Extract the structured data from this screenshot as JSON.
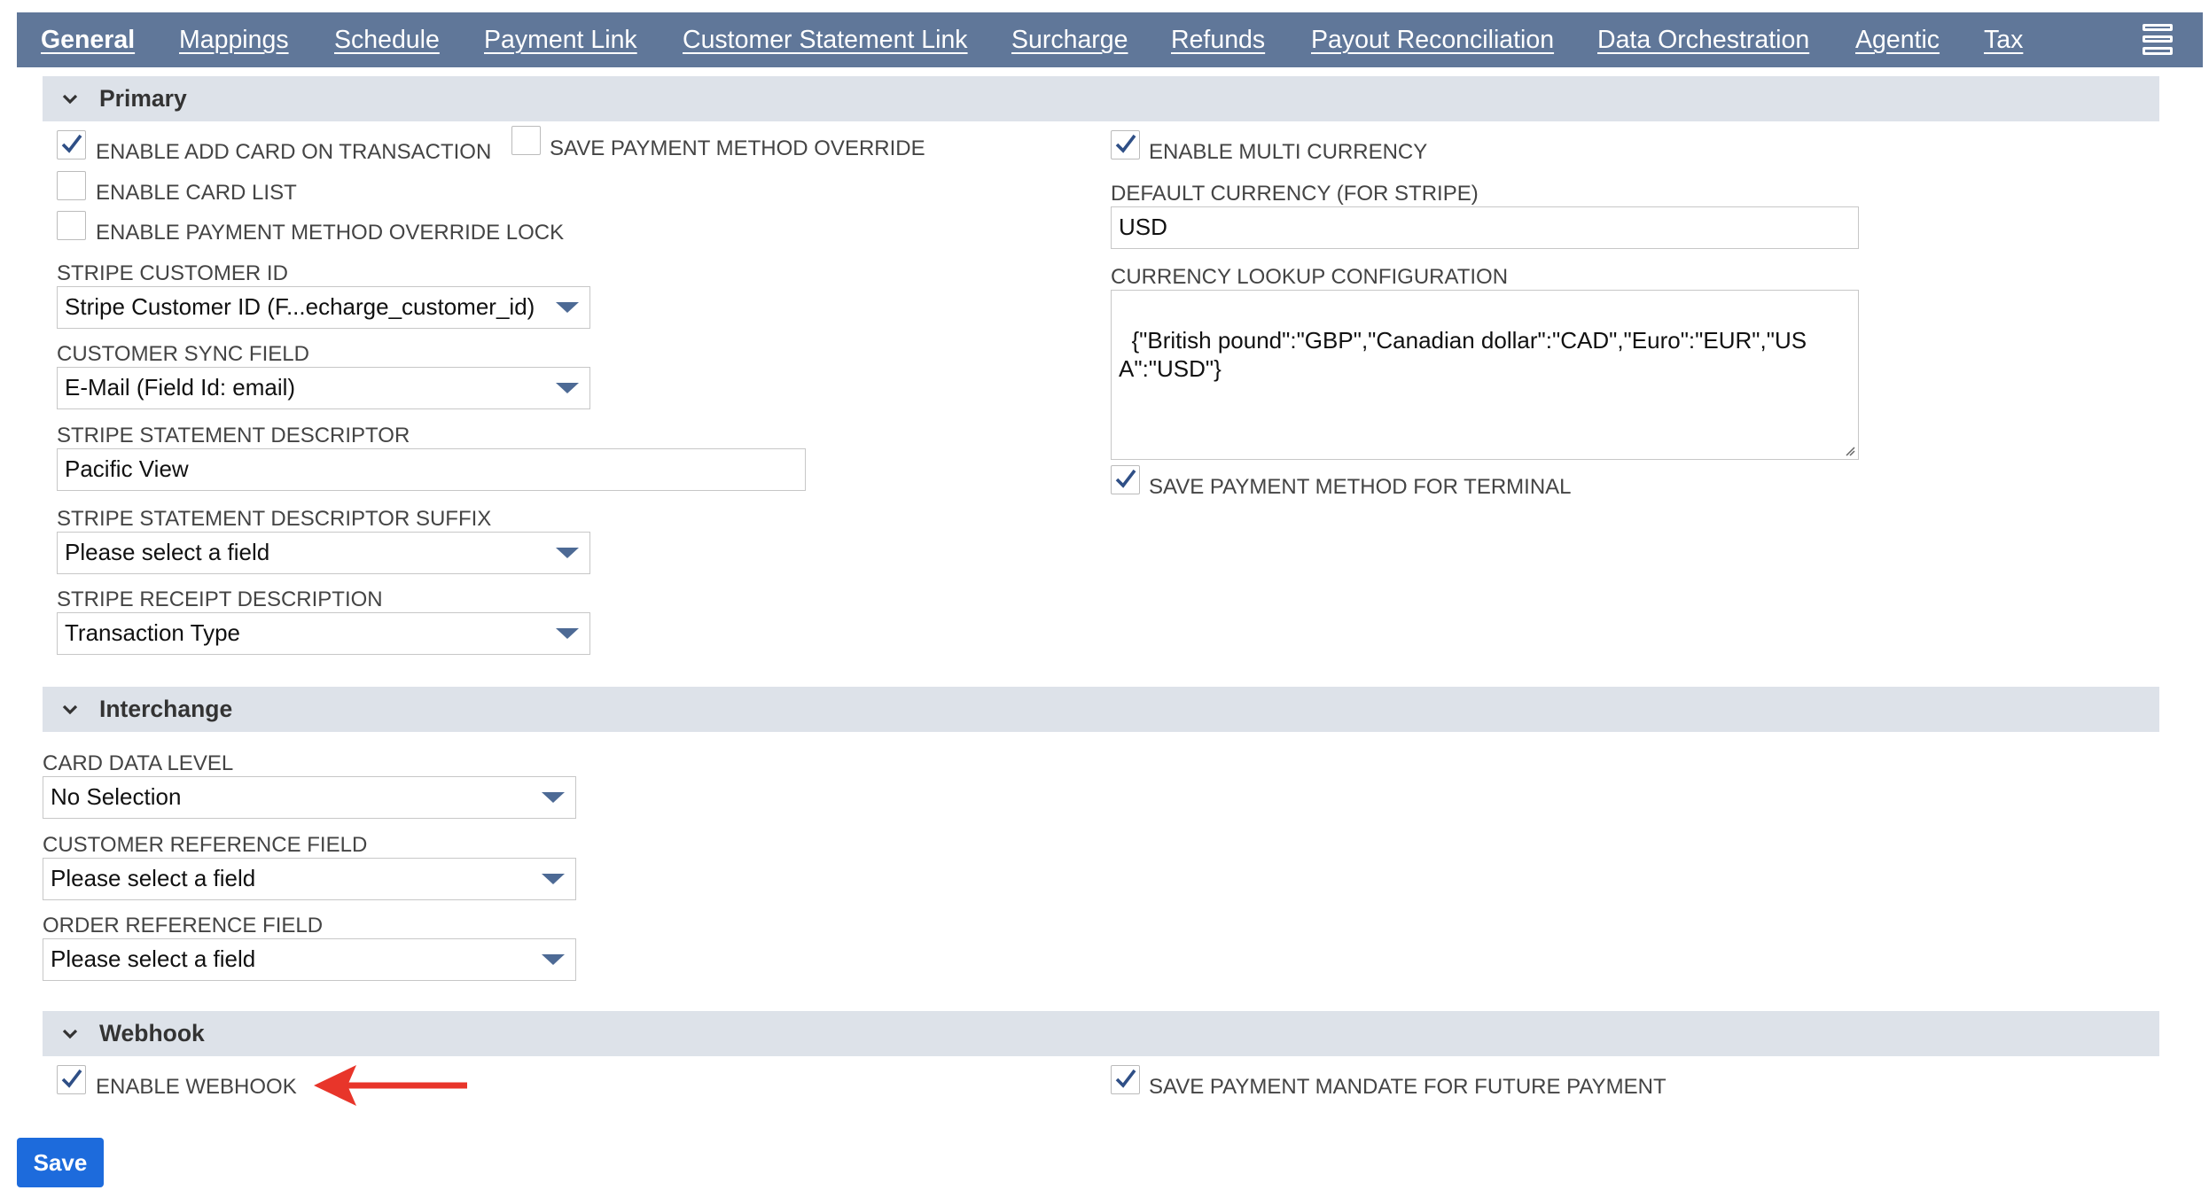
{
  "tabs": [
    {
      "label": "General",
      "active": true
    },
    {
      "label": "Mappings"
    },
    {
      "label": "Schedule"
    },
    {
      "label": "Payment Link"
    },
    {
      "label": "Customer Statement Link"
    },
    {
      "label": "Surcharge"
    },
    {
      "label": "Refunds"
    },
    {
      "label": "Payout Reconciliation"
    },
    {
      "label": "Data Orchestration"
    },
    {
      "label": "Agentic"
    },
    {
      "label": "Tax"
    }
  ],
  "sections": {
    "primary": {
      "title": "Primary",
      "enable_add_card": {
        "label": "ENABLE ADD CARD ON TRANSACTION",
        "checked": true
      },
      "save_pm_override": {
        "label": "SAVE PAYMENT METHOD OVERRIDE",
        "checked": false
      },
      "enable_card_list": {
        "label": "ENABLE CARD LIST",
        "checked": false
      },
      "enable_pm_override_lock": {
        "label": "ENABLE PAYMENT METHOD OVERRIDE LOCK",
        "checked": false
      },
      "stripe_customer_id": {
        "label": "STRIPE CUSTOMER ID",
        "value": "Stripe Customer ID (F...echarge_customer_id)"
      },
      "customer_sync_field": {
        "label": "CUSTOMER SYNC FIELD",
        "value": "E-Mail (Field Id: email)"
      },
      "statement_descriptor": {
        "label": "STRIPE STATEMENT DESCRIPTOR",
        "value": "Pacific View"
      },
      "statement_descriptor_suffix": {
        "label": "STRIPE STATEMENT DESCRIPTOR SUFFIX",
        "value": "Please select a field"
      },
      "receipt_description": {
        "label": "STRIPE RECEIPT DESCRIPTION",
        "value": "Transaction Type"
      },
      "enable_multi_currency": {
        "label": "ENABLE MULTI CURRENCY",
        "checked": true
      },
      "default_currency": {
        "label": "DEFAULT CURRENCY (FOR STRIPE)",
        "value": "USD"
      },
      "currency_lookup": {
        "label": "CURRENCY LOOKUP CONFIGURATION",
        "value": "{\"British pound\":\"GBP\",\"Canadian dollar\":\"CAD\",\"Euro\":\"EUR\",\"USA\":\"USD\"}"
      },
      "save_pm_terminal": {
        "label": "SAVE PAYMENT METHOD FOR TERMINAL",
        "checked": true
      }
    },
    "interchange": {
      "title": "Interchange",
      "card_data_level": {
        "label": "CARD DATA LEVEL",
        "value": "No Selection"
      },
      "customer_reference": {
        "label": "CUSTOMER REFERENCE FIELD",
        "value": "Please select a field"
      },
      "order_reference": {
        "label": "ORDER REFERENCE FIELD",
        "value": "Please select a field"
      }
    },
    "webhook": {
      "title": "Webhook",
      "enable_webhook": {
        "label": "ENABLE WEBHOOK",
        "checked": true
      },
      "save_mandate": {
        "label": "SAVE PAYMENT MANDATE FOR FUTURE PAYMENT",
        "checked": true
      }
    }
  },
  "save_label": "Save",
  "colors": {
    "tabbar": "#607799",
    "section": "#dde2e9",
    "save": "#1d6bdc",
    "check": "#2f4f86",
    "annotation": "#e8352a"
  }
}
